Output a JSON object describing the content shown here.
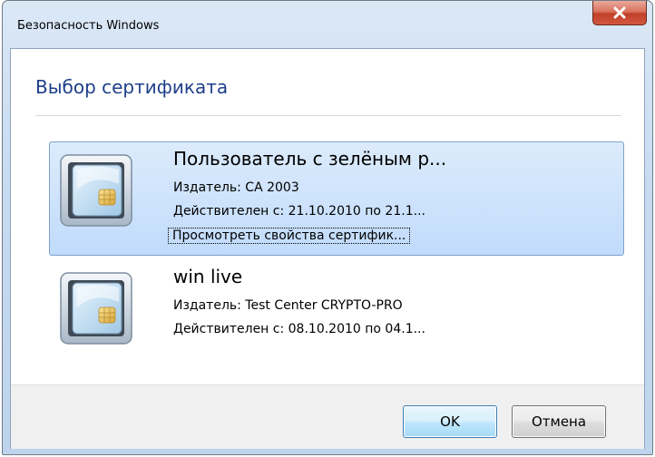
{
  "window": {
    "title": "Безопасность Windows",
    "close_label": "x"
  },
  "dialog": {
    "heading": "Выбор сертификата"
  },
  "certificates": [
    {
      "name": "Пользователь с зелёным р...",
      "issuer": "Издатель: CA 2003",
      "valid": "Действителен с: 21.10.2010 по 21.1...",
      "link": "Просмотреть свойства сертифик...",
      "selected": true
    },
    {
      "name": "win live",
      "issuer": "Издатель: Test Center CRYPTO-PRO",
      "valid": "Действителен с: 08.10.2010 по 04.1...",
      "selected": false
    }
  ],
  "buttons": {
    "ok_label": "OK",
    "cancel_label": "Отмена"
  },
  "icons": {
    "close": "close-icon",
    "certificate": "smart-card-icon"
  },
  "colors": {
    "heading": "#1e3f8a",
    "selection": "#c1dbfc",
    "close_button": "#c0402a"
  }
}
